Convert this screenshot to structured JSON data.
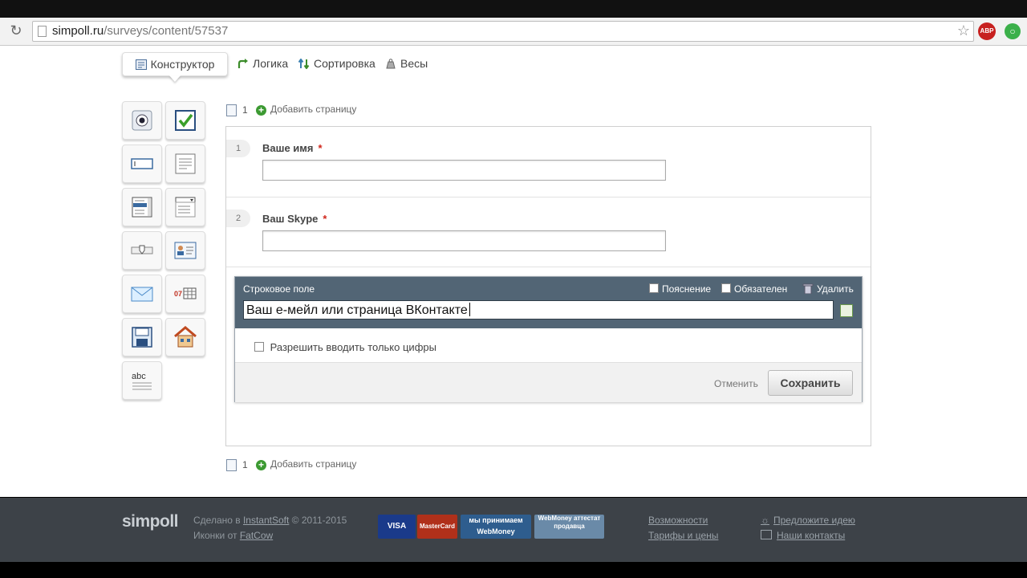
{
  "browser": {
    "url_host": "simpoll.ru",
    "url_path": "/surveys/content/57537",
    "abp_label": "ABP"
  },
  "tabs": [
    {
      "label": "Конструктор",
      "icon": "designer-icon",
      "active": true
    },
    {
      "label": "Логика",
      "icon": "logic-arrow-icon"
    },
    {
      "label": "Сортировка",
      "icon": "sort-icon"
    },
    {
      "label": "Весы",
      "icon": "weight-icon"
    }
  ],
  "toolbox": [
    "radio-icon",
    "checkbox-icon",
    "text-input-icon",
    "textarea-icon",
    "listbox-icon",
    "dropdown-icon",
    "slider-icon",
    "contact-card-icon",
    "email-icon",
    "date-icon",
    "form-save-icon",
    "address-house-icon",
    "abc-text-icon"
  ],
  "toolbox_abc_label": "abc",
  "toolbox_date_label": "07",
  "page_bar": {
    "page_number": "1",
    "add_page_label": "Добавить страницу"
  },
  "questions": [
    {
      "number": "1",
      "label": "Ваше имя",
      "required_mark": "*"
    },
    {
      "number": "2",
      "label": "Ваш Skype",
      "required_mark": "*"
    }
  ],
  "editor": {
    "field_type": "Строковое поле",
    "option_explanation": "Пояснение",
    "option_required": "Обязателен",
    "delete_label": "Удалить",
    "title_value": "Ваш е-мейл или страница ВКонтакте",
    "digits_only_label": "Разрешить вводить только цифры",
    "cancel_label": "Отменить",
    "save_label": "Сохранить"
  },
  "footer": {
    "logo": "simpoll",
    "made_prefix": "Сделано в ",
    "made_link": "InstantSoft",
    "made_suffix": " © 2011-2015",
    "icons_prefix": "Иконки от ",
    "icons_link": "FatCow",
    "payments": [
      "VISA",
      "MasterCard",
      "мы принимаем WebMoney",
      "WebMoney аттестат продавца"
    ],
    "features_link": "Возможности",
    "pricing_link": "Тарифы и цены",
    "suggest_link": "Предложите идею",
    "contacts_link": "Наши контакты"
  },
  "colors": {
    "editor_header": "#526575",
    "footer_bg": "#3d4248",
    "required": "#d0261b"
  }
}
